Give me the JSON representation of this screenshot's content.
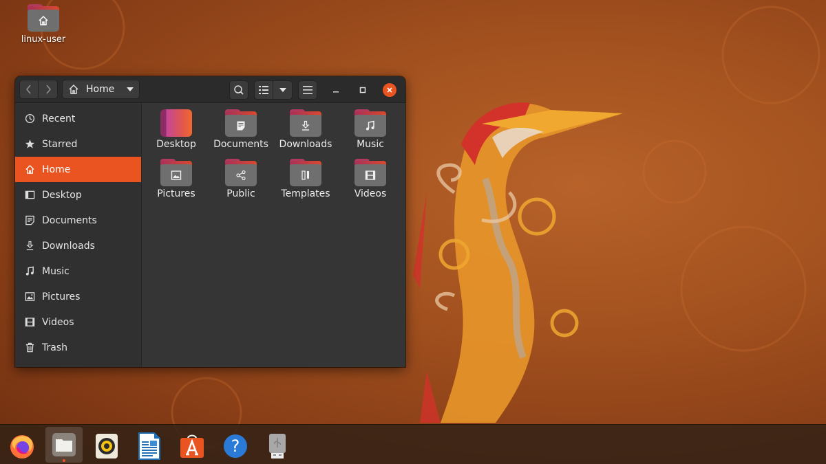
{
  "desktop": {
    "icons": [
      {
        "label": "linux-user",
        "icon": "home-folder-icon"
      }
    ]
  },
  "window": {
    "path_label": "Home",
    "buttons": {
      "back": "back",
      "forward": "forward",
      "search": "search",
      "view_list": "list-view",
      "view_options": "view-options",
      "menu": "menu",
      "minimize": "minimize",
      "maximize": "maximize",
      "close": "close"
    },
    "sidebar": {
      "items": [
        {
          "label": "Recent",
          "icon": "clock-icon",
          "active": false
        },
        {
          "label": "Starred",
          "icon": "star-icon",
          "active": false
        },
        {
          "label": "Home",
          "icon": "home-icon",
          "active": true
        },
        {
          "label": "Desktop",
          "icon": "desktop-icon",
          "active": false
        },
        {
          "label": "Documents",
          "icon": "document-icon",
          "active": false
        },
        {
          "label": "Downloads",
          "icon": "download-icon",
          "active": false
        },
        {
          "label": "Music",
          "icon": "music-icon",
          "active": false
        },
        {
          "label": "Pictures",
          "icon": "picture-icon",
          "active": false
        },
        {
          "label": "Videos",
          "icon": "video-icon",
          "active": false
        },
        {
          "label": "Trash",
          "icon": "trash-icon",
          "active": false
        }
      ]
    },
    "files": [
      {
        "label": "Desktop",
        "icon": "desktop-folder-icon"
      },
      {
        "label": "Documents",
        "icon": "documents-folder-icon"
      },
      {
        "label": "Downloads",
        "icon": "downloads-folder-icon"
      },
      {
        "label": "Music",
        "icon": "music-folder-icon"
      },
      {
        "label": "Pictures",
        "icon": "pictures-folder-icon"
      },
      {
        "label": "Public",
        "icon": "public-folder-icon"
      },
      {
        "label": "Templates",
        "icon": "templates-folder-icon"
      },
      {
        "label": "Videos",
        "icon": "videos-folder-icon"
      }
    ]
  },
  "dock": {
    "apps": [
      {
        "name": "Firefox",
        "icon": "firefox-icon",
        "running": false
      },
      {
        "name": "Files",
        "icon": "files-icon",
        "running": true
      },
      {
        "name": "Rhythmbox",
        "icon": "rhythmbox-icon",
        "running": false
      },
      {
        "name": "LibreOffice Writer",
        "icon": "writer-icon",
        "running": false
      },
      {
        "name": "Ubuntu Software",
        "icon": "software-icon",
        "running": false
      },
      {
        "name": "Help",
        "icon": "help-icon",
        "running": false
      },
      {
        "name": "USB Drive",
        "icon": "usb-drive-icon",
        "running": false
      }
    ]
  },
  "colors": {
    "accent": "#e95420",
    "window_bg": "#353535",
    "headerbar_bg": "#2b2b2b",
    "sidebar_bg": "#303030"
  }
}
